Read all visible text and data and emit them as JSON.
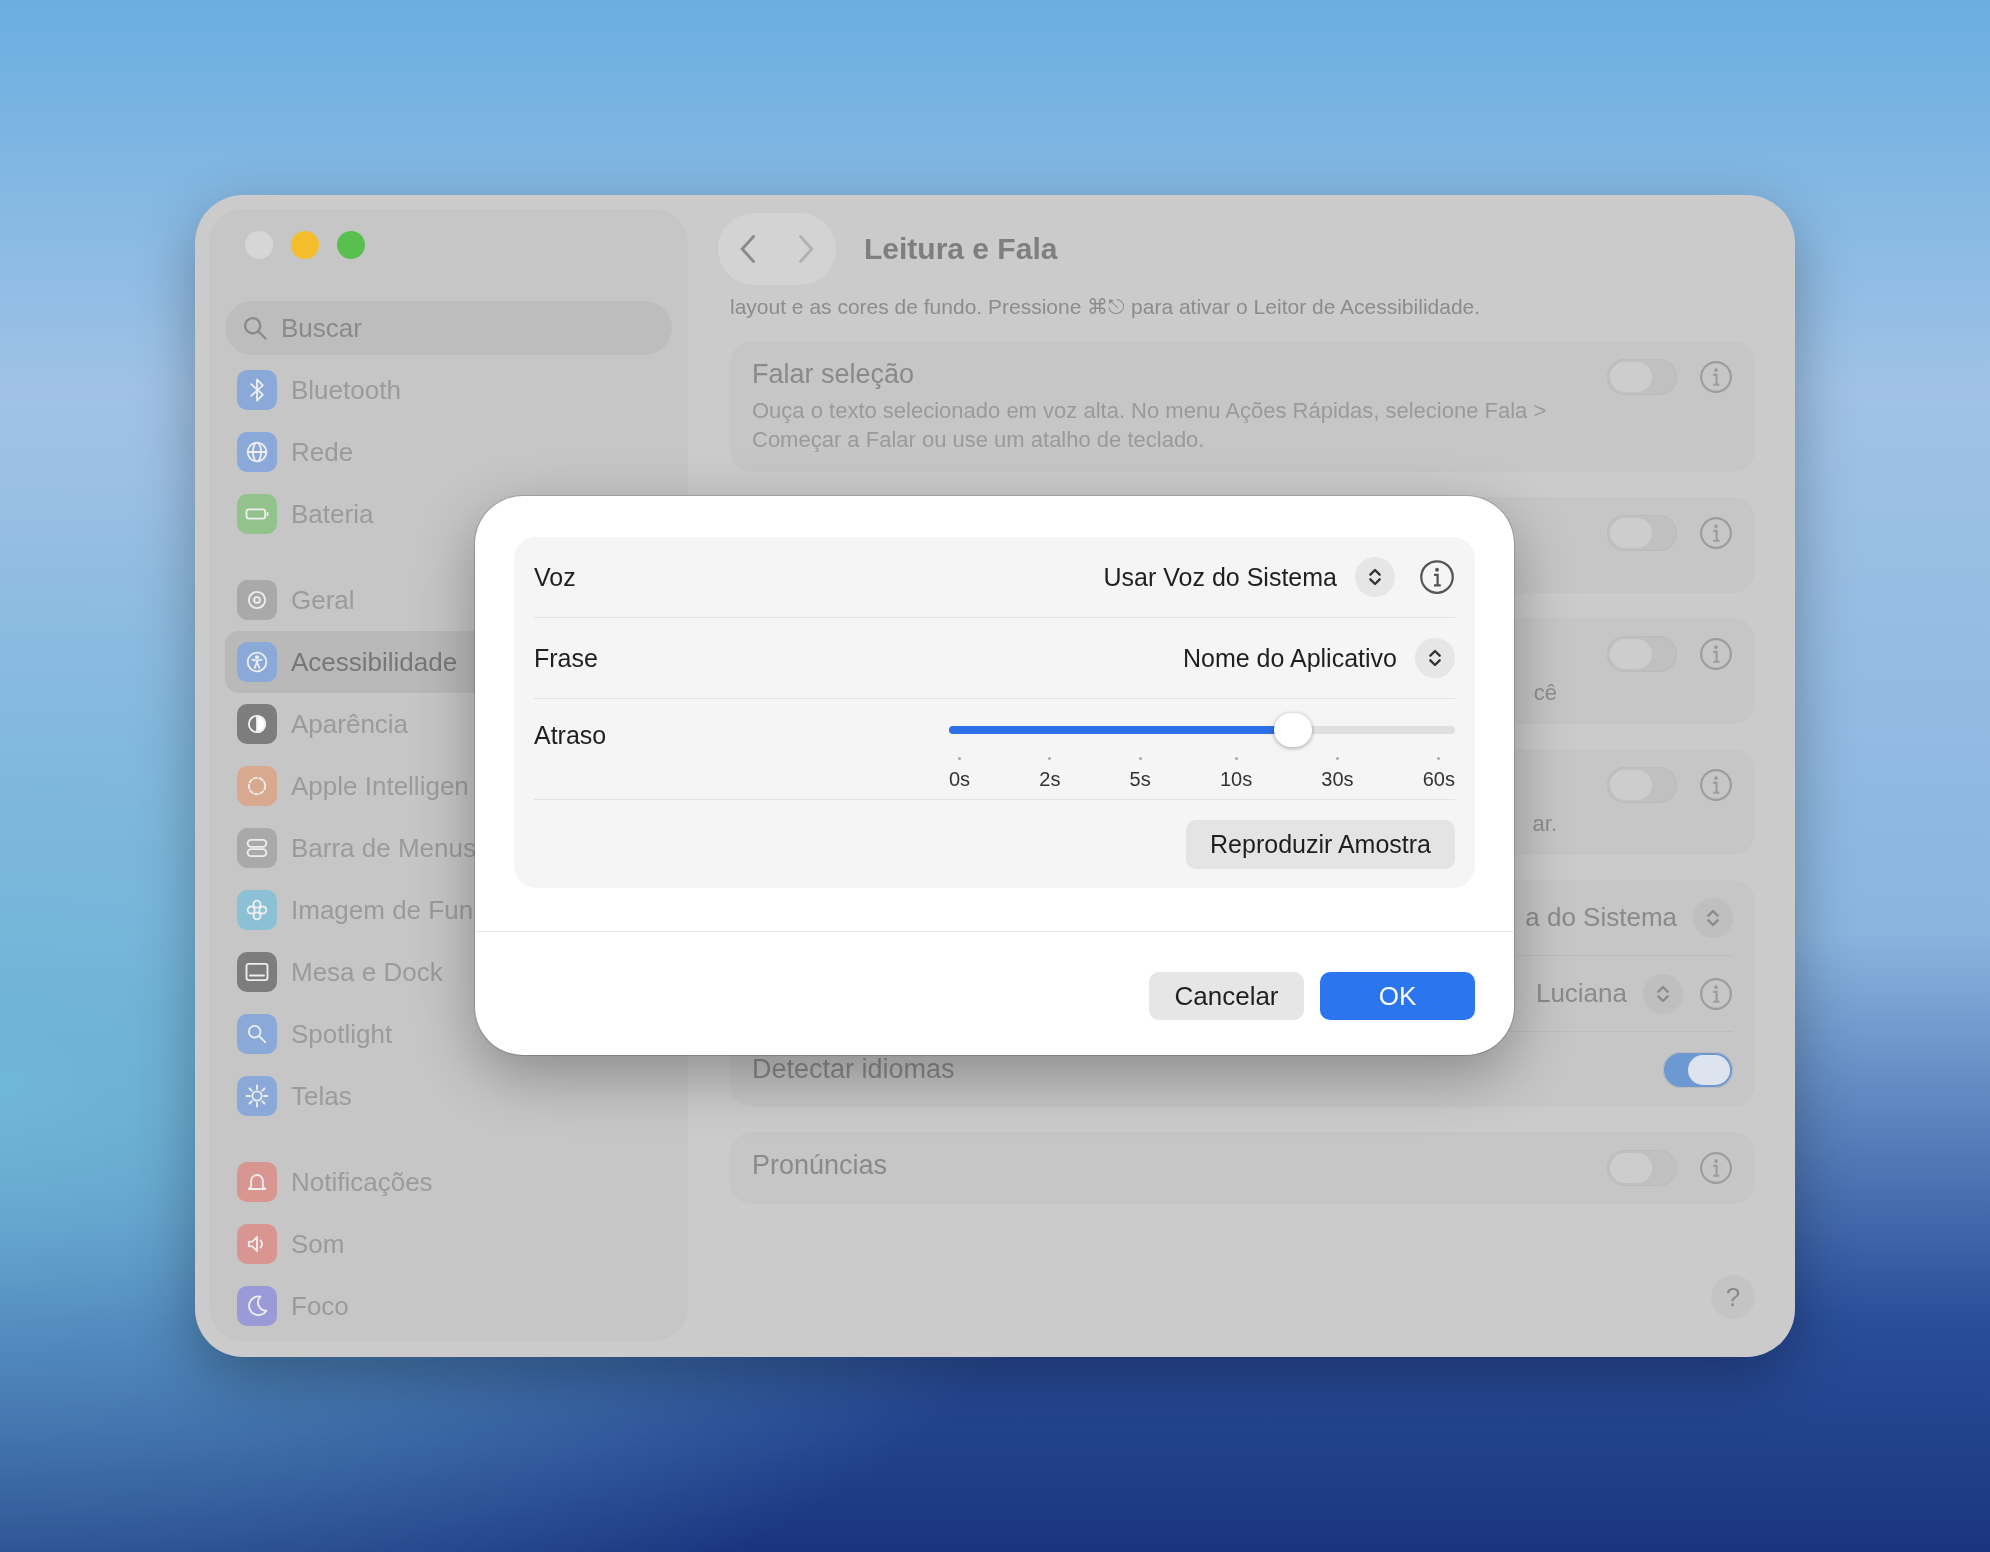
{
  "window": {
    "traffic_lights": [
      {
        "color": "#d6d6d6"
      },
      {
        "color": "#f4bd2c"
      },
      {
        "color": "#58c04f"
      }
    ]
  },
  "toolbar": {
    "title": "Leitura e Fala",
    "back_disabled": false,
    "forward_disabled": true
  },
  "sidebar": {
    "search": {
      "placeholder": "Buscar"
    },
    "groups": [
      [
        {
          "label": "Bluetooth",
          "color": "#8aa9d8",
          "selected": false
        },
        {
          "label": "Rede",
          "color": "#8aa9d8",
          "selected": false
        },
        {
          "label": "Bateria",
          "color": "#93c38c",
          "selected": false
        }
      ],
      [
        {
          "label": "Geral",
          "color": "#a9a9a9",
          "selected": false
        },
        {
          "label": "Acessibilidade",
          "color": "#8aa9d8",
          "selected": true
        },
        {
          "label": "Aparência",
          "color": "#7d7d7d",
          "selected": false
        },
        {
          "label": "Apple Intelligen",
          "color": "#d8a98f",
          "selected": false
        },
        {
          "label": "Barra de Menus",
          "color": "#a9a9a9",
          "selected": false
        },
        {
          "label": "Imagem de Fun",
          "color": "#8cc0d4",
          "selected": false
        },
        {
          "label": "Mesa e Dock",
          "color": "#7d7d7d",
          "selected": false
        },
        {
          "label": "Spotlight",
          "color": "#8aa9d8",
          "selected": false
        },
        {
          "label": "Telas",
          "color": "#8aa9d8",
          "selected": false
        }
      ],
      [
        {
          "label": "Notificações",
          "color": "#d99590",
          "selected": false
        },
        {
          "label": "Som",
          "color": "#d99590",
          "selected": false
        },
        {
          "label": "Foco",
          "color": "#9a9ad8",
          "selected": false
        }
      ]
    ]
  },
  "content": {
    "intro": "layout e as cores de fundo. Pressione ⌘⎋ para ativar o Leitor de Acessibilidade.",
    "cards": [
      {
        "kind": "toggle",
        "title": "Falar seleção",
        "description": "Ouça o texto selecionado em voz alta. No menu Ações Rápidas, selecione Fala > Começar a Falar ou use um atalho de teclado.",
        "on": false,
        "info": true
      },
      {
        "kind": "toggle",
        "on": false,
        "info": true
      },
      {
        "kind": "toggle",
        "fragment": "cê",
        "on": false,
        "info": true
      },
      {
        "kind": "toggle",
        "fragment": "ar.",
        "on": false,
        "info": true
      },
      {
        "kind": "group",
        "rows": [
          {
            "kind": "popup",
            "value": "a do Sistema",
            "info": false
          },
          {
            "kind": "popup",
            "value": "Luciana",
            "info": true
          },
          {
            "kind": "toggle",
            "label": "Detectar idiomas",
            "on": true
          }
        ]
      },
      {
        "kind": "toggle",
        "title": "Pronúncias",
        "on": false,
        "info": true
      }
    ],
    "help": "?"
  },
  "dialog": {
    "rows": [
      {
        "kind": "popup",
        "label": "Voz",
        "value": "Usar Voz do Sistema",
        "info": true
      },
      {
        "kind": "popup",
        "label": "Frase",
        "value": "Nome do Aplicativo",
        "info": false
      },
      {
        "kind": "slider",
        "label": "Atraso",
        "level": 0.68,
        "ticks": [
          "0s",
          "2s",
          "5s",
          "10s",
          "30s",
          "60s"
        ]
      }
    ],
    "sample_button": "Reproduzir Amostra",
    "buttons": [
      {
        "label": "Cancelar",
        "default": false
      },
      {
        "label": "OK",
        "default": true
      }
    ]
  }
}
